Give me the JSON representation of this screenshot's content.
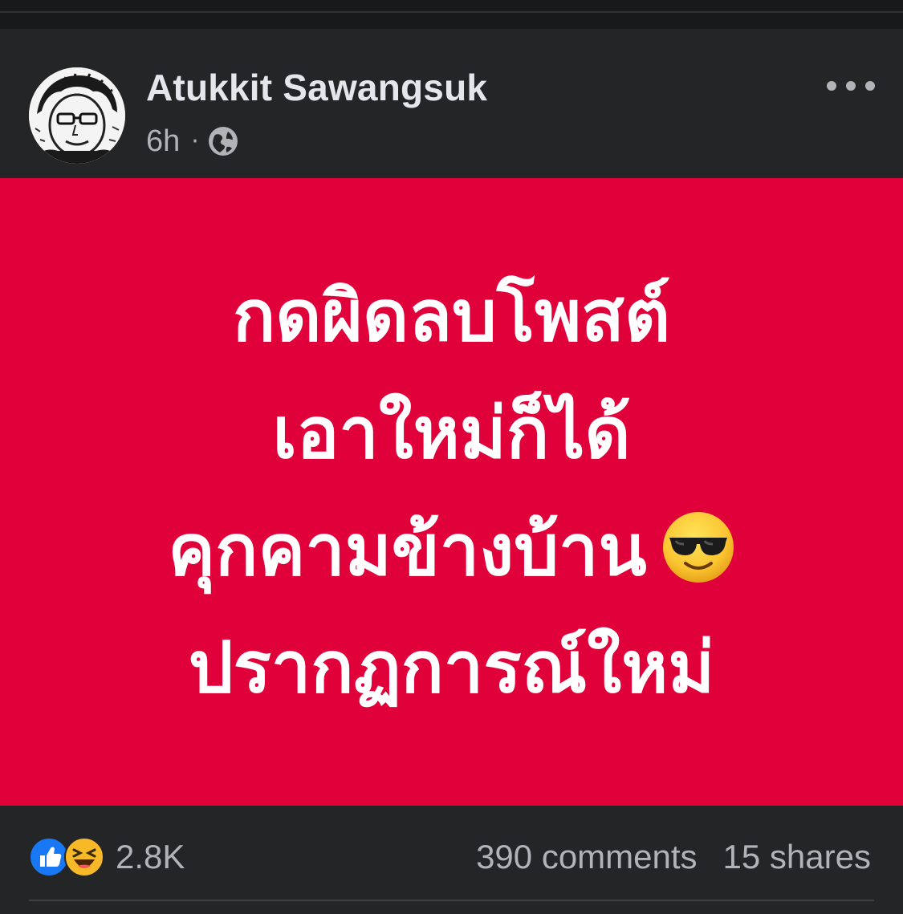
{
  "post": {
    "author": "Atukkit Sawangsuk",
    "timestamp": "6h",
    "separator": "·",
    "privacy_icon": "globe-icon",
    "background_color": "#e0003a",
    "text_color": "#ffffff",
    "lines": [
      "กดผิดลบโพสต์",
      "เอาใหม่ก็ได้",
      "คุกคามข้างบ้าน",
      "ปรากฏการณ์ใหม่"
    ],
    "emoji": "smiling-face-with-sunglasses"
  },
  "reactions": {
    "icons": [
      "like-icon",
      "haha-icon"
    ],
    "count": "2.8K"
  },
  "stats": {
    "comments": "390 comments",
    "shares": "15 shares"
  },
  "colors": {
    "surface": "#242526",
    "text_primary": "#e4e6eb",
    "text_secondary": "#b0b3b8",
    "like_blue": "#1877f2",
    "haha_yellow": "#f7b928"
  }
}
